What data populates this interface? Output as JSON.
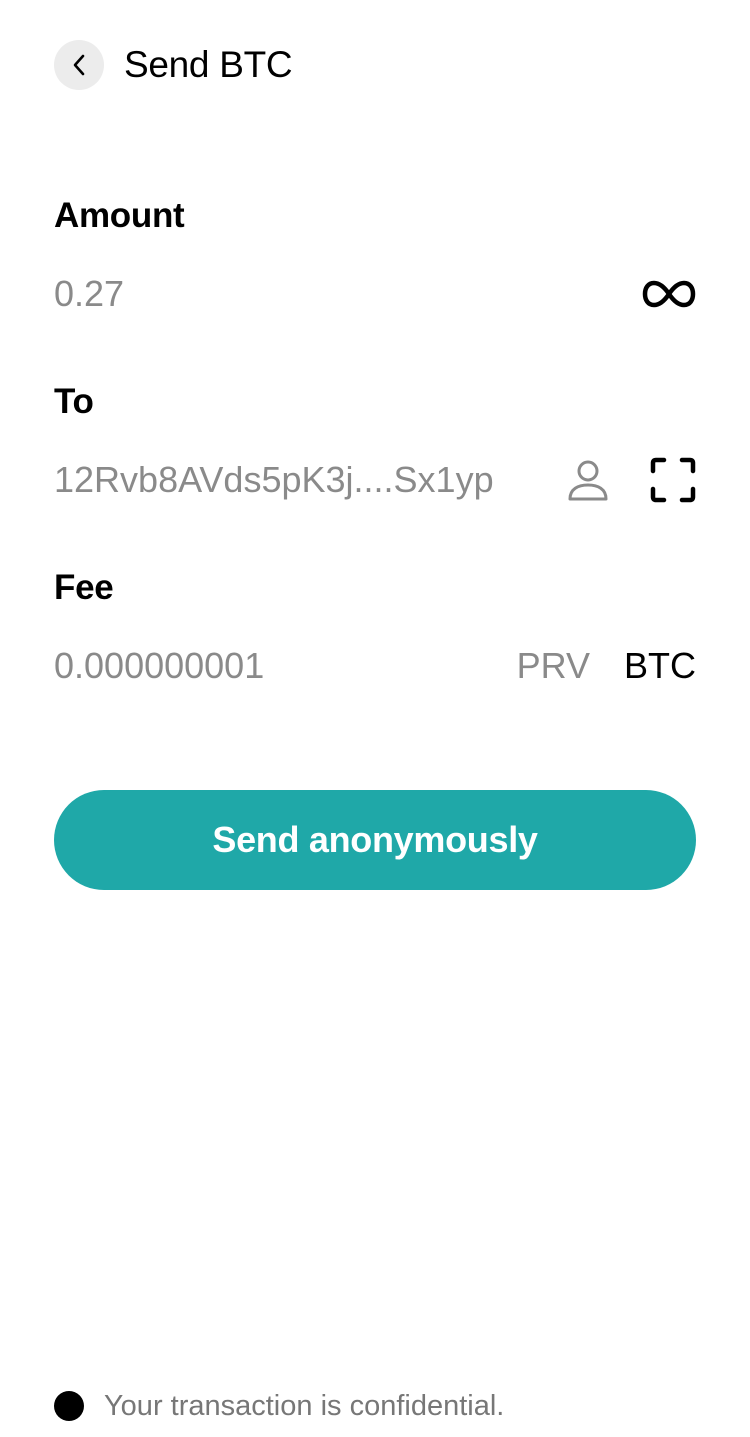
{
  "header": {
    "title": "Send BTC",
    "back_icon": "chevron-left-icon"
  },
  "amount": {
    "label": "Amount",
    "value": "0.27",
    "max_icon": "infinity-icon"
  },
  "to": {
    "label": "To",
    "value": "12Rvb8AVds5pK3j....Sx1yp",
    "contact_icon": "person-icon",
    "scan_icon": "scan-qr-icon"
  },
  "fee": {
    "label": "Fee",
    "value": "0.000000001",
    "options": [
      "PRV",
      "BTC"
    ],
    "selected": "BTC"
  },
  "send_button": {
    "label": "Send anonymously"
  },
  "footer": {
    "text": "Your transaction is confidential."
  },
  "colors": {
    "accent": "#1fa8a8",
    "muted_text": "#8a8a8a",
    "back_button_bg": "#ececec"
  }
}
